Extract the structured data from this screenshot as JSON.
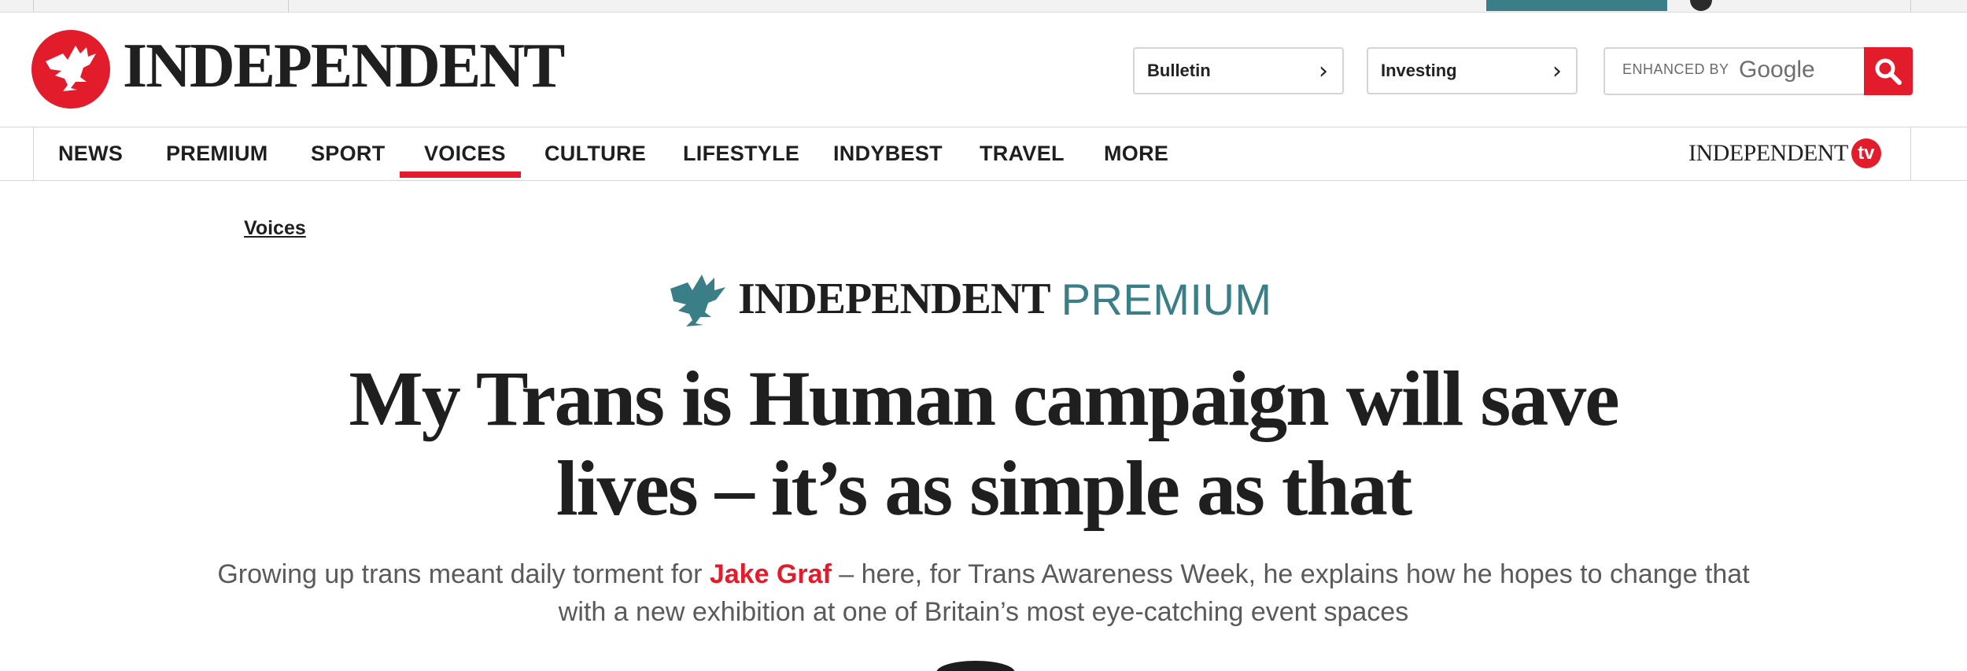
{
  "header": {
    "logo_text": "INDEPENDENT",
    "pills": [
      {
        "label": "Bulletin"
      },
      {
        "label": "Investing"
      }
    ],
    "search": {
      "enhanced_label": "ENHANCED BY",
      "google_label": "Google"
    }
  },
  "nav": {
    "items": [
      {
        "label": "NEWS"
      },
      {
        "label": "PREMIUM"
      },
      {
        "label": "SPORT"
      },
      {
        "label": "VOICES"
      },
      {
        "label": "CULTURE"
      },
      {
        "label": "LIFESTYLE"
      },
      {
        "label": "INDYBEST"
      },
      {
        "label": "TRAVEL"
      },
      {
        "label": "MORE"
      }
    ],
    "active": "VOICES",
    "tv_logo_text": "INDEPENDENT",
    "tv_badge": "tv"
  },
  "article": {
    "breadcrumb": "Voices",
    "premium_brand": "INDEPENDENT",
    "premium_label": "PREMIUM",
    "headline_line1": "My Trans is Human campaign will save",
    "headline_line2": "lives – it’s as simple as that",
    "standfirst_pre": "Growing up trans meant daily torment for ",
    "standfirst_author": "Jake Graf",
    "standfirst_post": " – here, for Trans Awareness Week, he explains how he hopes to change that with a new exhibition at one of Britain’s most eye-catching event spaces"
  },
  "colors": {
    "brand_red": "#e31c2c",
    "premium_teal": "#3a7f87"
  }
}
